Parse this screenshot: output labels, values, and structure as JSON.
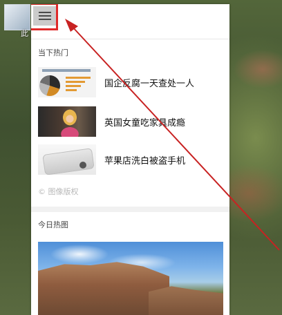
{
  "desktop": {
    "icon_label": "此"
  },
  "panel": {
    "menu_icon": "hamburger-menu-icon",
    "hot_section": {
      "title": "当下热门"
    },
    "news": [
      {
        "title": "国企反腐一天查处一人",
        "thumb": "chart-thumbnail"
      },
      {
        "title": "英国女童吃家具成瘾",
        "thumb": "girl-thumbnail"
      },
      {
        "title": "苹果店洗白被盗手机",
        "thumb": "phone-thumbnail"
      }
    ],
    "copyright": "© 图像版权",
    "today_section": {
      "title": "今日热图"
    }
  },
  "annotation": {
    "highlight_color": "#e02a2a",
    "arrow_color": "#c82222"
  }
}
